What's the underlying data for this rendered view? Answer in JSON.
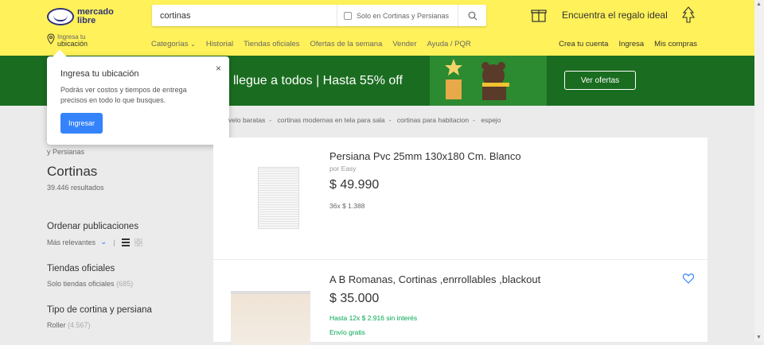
{
  "header": {
    "logo_text_line1": "mercado",
    "logo_text_line2": "libre",
    "search_value": "cortinas",
    "search_checkbox_label": "Solo en Cortinas y Persianas",
    "promo_text": "Encuentra el regalo ideal",
    "location_line1": "Ingresa tu",
    "location_line2": "ubicación",
    "nav": [
      "Categorías",
      "Historial",
      "Tiendas oficiales",
      "Ofertas de la semana",
      "Vender",
      "Ayuda / PQR"
    ],
    "user_nav": [
      "Crea tu cuenta",
      "Ingresa",
      "Mis compras"
    ]
  },
  "banner": {
    "text": "llegue a todos | Hasta 55% off",
    "button": "Ver ofertas"
  },
  "popup": {
    "title": "Ingresa tu ubicación",
    "body": "Podrás ver costos y tiempos de entrega precisos en todo lo que busques.",
    "button": "Ingresar",
    "close": "×"
  },
  "breadcrumbs": [
    "velo baratas",
    "cortinas modernas en tela para sala",
    "cortinas para habitacion",
    "espejo"
  ],
  "sidebar": {
    "breadcrumb_tail": "y Persianas",
    "title": "Cortinas",
    "count": "39.446 resultados",
    "sort_heading": "Ordenar publicaciones",
    "sort_value": "Más relevantes",
    "official_heading": "Tiendas oficiales",
    "official_item": "Solo tiendas oficiales",
    "official_count": "(685)",
    "type_heading": "Tipo de cortina y persiana",
    "type_item": "Roller",
    "type_count": "(4.567)"
  },
  "results": [
    {
      "title": "Persiana Pvc 25mm 130x180 Cm. Blanco",
      "seller": "por Easy",
      "price": "$ 49.990",
      "installments": "36x $ 1.388"
    },
    {
      "title": "A B Romanas, Cortinas ,enrrollables ,blackout",
      "price": "$ 35.000",
      "installments": "Hasta 12x $ 2.916 sin interés",
      "shipping": "Envío gratis"
    }
  ],
  "colors": {
    "header_bg": "#fff159",
    "banner_bg": "#1a6d20",
    "primary_button": "#3483fa",
    "green_text": "#00a650"
  }
}
